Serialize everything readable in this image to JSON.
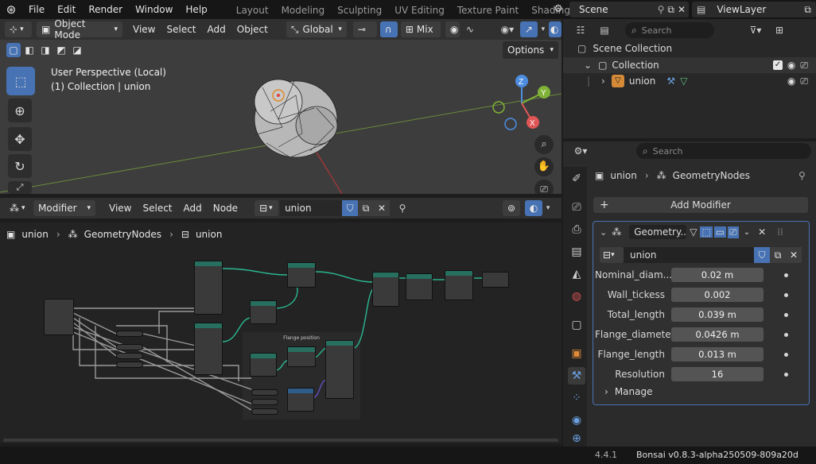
{
  "menu": {
    "items": [
      "File",
      "Edit",
      "Render",
      "Window",
      "Help"
    ],
    "workspaces": [
      "Layout",
      "Modeling",
      "Sculpting",
      "UV Editing",
      "Texture Paint",
      "Shading"
    ],
    "scene": "Scene",
    "view_layer": "ViewLayer"
  },
  "viewport": {
    "mode": "Object Mode",
    "menus": [
      "View",
      "Select",
      "Add",
      "Object"
    ],
    "orientation": "Global",
    "mix": "Mix",
    "options": "Options",
    "info_line1": "User Perspective (Local)",
    "info_line2": "(1) Collection | union",
    "gizmo": {
      "x": "X",
      "y": "Y",
      "z": "Z"
    }
  },
  "node_editor": {
    "editor_type": "Modifier",
    "menus": [
      "View",
      "Select",
      "Add",
      "Node"
    ],
    "node_group": "union",
    "breadcrumb": [
      "union",
      "GeometryNodes",
      "union"
    ],
    "frame_label": "Flange position"
  },
  "outliner": {
    "search_placeholder": "Search",
    "scene_collection": "Scene Collection",
    "collection": "Collection",
    "object": "union"
  },
  "properties": {
    "search_placeholder": "Search",
    "breadcrumb_object": "union",
    "breadcrumb_modifier": "GeometryNodes",
    "add_modifier": "Add Modifier",
    "modifier_name": "Geometry...",
    "node_group": "union",
    "params": [
      {
        "label": "Nominal_diam...",
        "value": "0.02 m"
      },
      {
        "label": "Wall_tickess",
        "value": "0.002"
      },
      {
        "label": "Total_length",
        "value": "0.039 m"
      },
      {
        "label": "Flange_diameter",
        "value": "0.0426 m"
      },
      {
        "label": "Flange_length",
        "value": "0.013 m"
      },
      {
        "label": "Resolution",
        "value": "16"
      }
    ],
    "manage": "Manage"
  },
  "status": {
    "version": "4.4.1",
    "addon": "Bonsai v0.8.3-alpha250509-809a20d"
  }
}
